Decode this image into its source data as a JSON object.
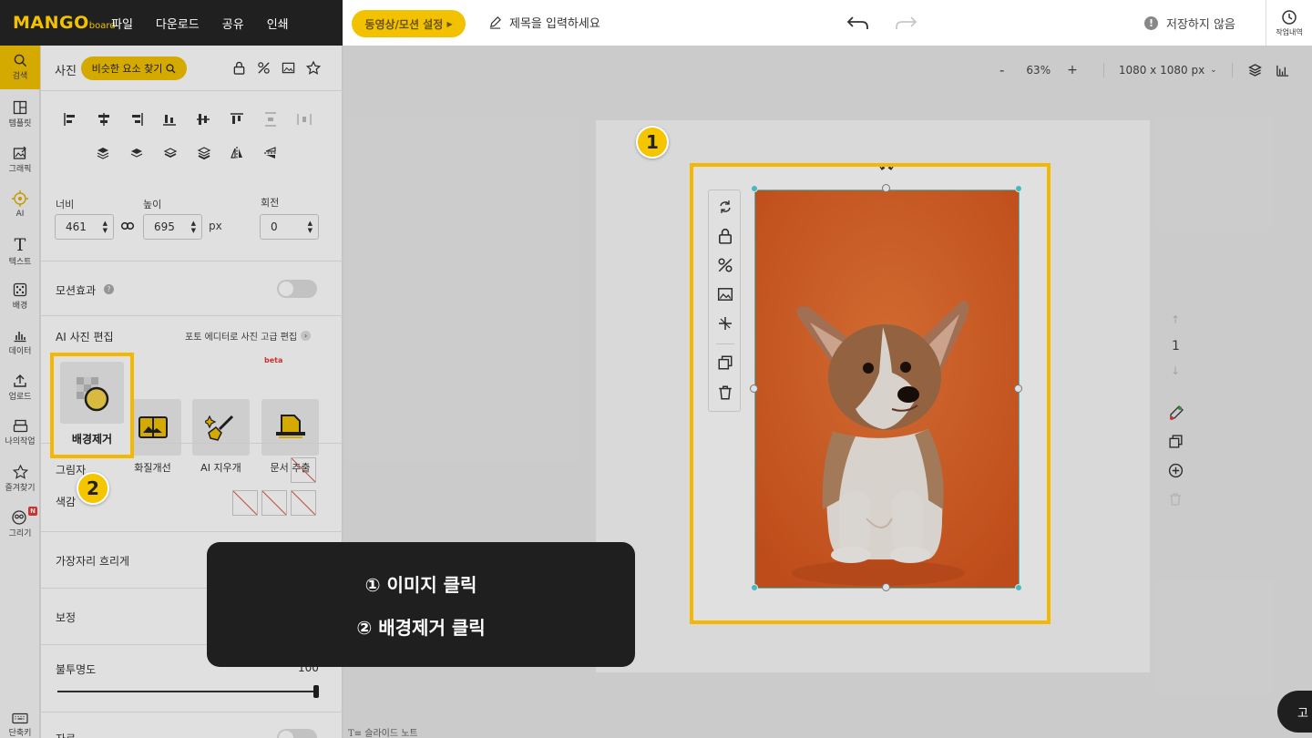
{
  "topbar": {
    "logo_main": "MANGO",
    "logo_sub": "board",
    "menu": [
      "파일",
      "다운로드",
      "공유",
      "인쇄"
    ],
    "video_button": "동영상/모션 설정",
    "title_placeholder": "제목을 입력하세요",
    "save_status": "저장하지 않음",
    "history_label": "작업내역"
  },
  "rail": {
    "items": [
      {
        "label": "검색",
        "icon": "search-icon"
      },
      {
        "label": "템플릿",
        "icon": "template-icon"
      },
      {
        "label": "그래픽",
        "icon": "graphic-icon"
      },
      {
        "label": "AI",
        "icon": "ai-icon"
      },
      {
        "label": "텍스트",
        "icon": "text-icon"
      },
      {
        "label": "배경",
        "icon": "background-icon"
      },
      {
        "label": "데이터",
        "icon": "chart-icon"
      },
      {
        "label": "업로드",
        "icon": "upload-icon"
      },
      {
        "label": "나의작업",
        "icon": "my-work-icon"
      },
      {
        "label": "즐겨찾기",
        "icon": "star-icon"
      },
      {
        "label": "그리기",
        "icon": "draw-icon"
      },
      {
        "label": "단축키",
        "icon": "keyboard-icon"
      }
    ],
    "new_badge": "N"
  },
  "panel": {
    "title": "사진",
    "similar_button": "비슷한 요소 찾기",
    "width_label": "너비",
    "width_value": "461",
    "height_label": "높이",
    "height_value": "695",
    "unit": "px",
    "rotation_label": "회전",
    "rotation_value": "0",
    "motion_label": "모션효과",
    "ai_edit_title": "AI 사진 편집",
    "photo_editor_link": "포토 에디터로 사진 고급 편집",
    "tools": [
      {
        "label": "배경제거"
      },
      {
        "label": "화질개선"
      },
      {
        "label": "AI 지우개"
      },
      {
        "label": "문서 추출",
        "badge": "beta"
      }
    ],
    "shadow_label": "그림자",
    "color_label": "색감",
    "blur_label": "가장자리 흐리게",
    "correction_label": "보정",
    "opacity_label": "불투명도",
    "opacity_value": "100",
    "bottom_label": "자르"
  },
  "canvas": {
    "zoom_minus": "-",
    "zoom_value": "63%",
    "zoom_plus": "+",
    "canvas_size": "1080 x 1080 px",
    "page_number": "1",
    "slide_note": "슬라이드 노트",
    "cta_partial": "고"
  },
  "tutorial": {
    "badge1": "1",
    "badge2": "2",
    "step1": "① 이미지 클릭",
    "step2": "② 배경제거 클릭"
  },
  "colors": {
    "accent": "#f2c200",
    "highlight": "#f5b800",
    "photo_background": "#e5672a",
    "selection": "#4cd6d6",
    "dark": "#202020"
  }
}
